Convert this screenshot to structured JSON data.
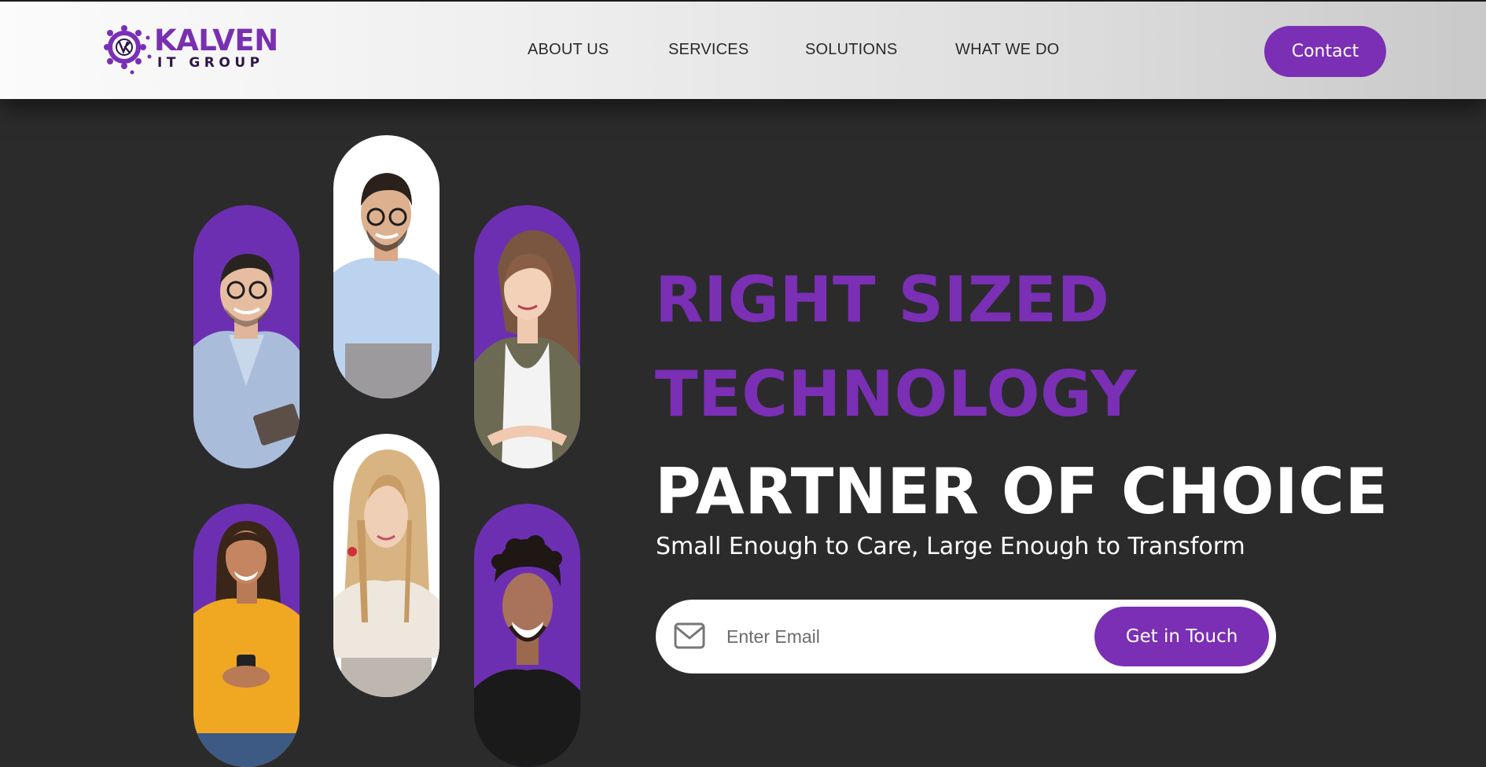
{
  "brand": {
    "name": "KALVEN",
    "sub": "IT GROUP",
    "color_primary": "#7a2fb5",
    "color_dark": "#2d1745"
  },
  "nav": {
    "items": [
      {
        "label": "ABOUT US"
      },
      {
        "label": "SERVICES"
      },
      {
        "label": "SOLUTIONS"
      },
      {
        "label": "WHAT WE DO"
      }
    ],
    "contact_label": "Contact"
  },
  "hero": {
    "headline_1": "RIGHT SIZED",
    "headline_2": "TECHNOLOGY",
    "headline_3": "PARTNER OF CHOICE",
    "tagline": "Small Enough to Care, Large Enough to Transform",
    "email_placeholder": "Enter Email",
    "email_value": "",
    "cta_label": "Get in Touch",
    "background": "#2b2b2c",
    "accent": "#7a2fb5"
  },
  "portraits": [
    {
      "icon": "person-photo",
      "background": "purple"
    },
    {
      "icon": "person-photo",
      "background": "white"
    },
    {
      "icon": "person-photo",
      "background": "purple"
    },
    {
      "icon": "person-photo",
      "background": "purple"
    },
    {
      "icon": "person-photo",
      "background": "white"
    },
    {
      "icon": "person-photo",
      "background": "purple"
    }
  ]
}
